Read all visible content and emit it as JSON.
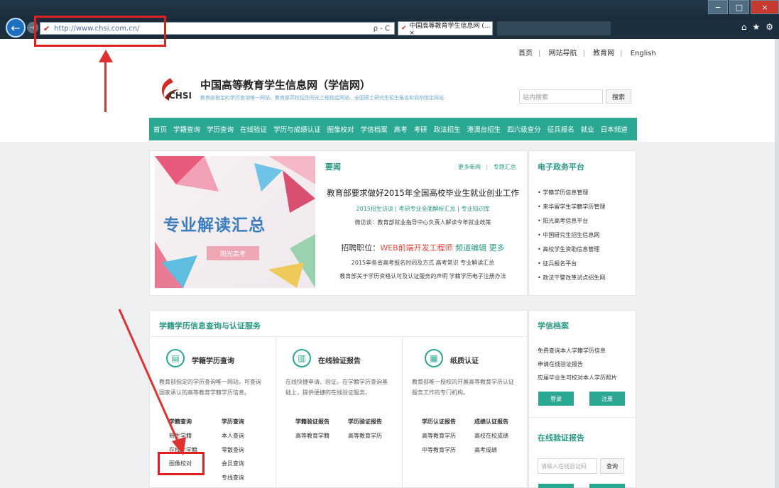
{
  "browser": {
    "url": "http://www.chsi.com.cn/",
    "tab_title": "中国高等教育学生信息网 (... ×",
    "addr_tools": "ρ - C"
  },
  "topnav": [
    "首页",
    "网站导航",
    "教育网",
    "English"
  ],
  "header": {
    "logo_text": "CHSI",
    "title": "中国高等教育学生信息网（学信网）",
    "subtitle": "教育部指定的学历查询唯一网站、教育部高校招生阳光工程指定网站、全国硕士研究生招生报名和调剂指定网站",
    "search_placeholder": "站内搜索",
    "search_button": "搜索"
  },
  "mainnav": [
    "首页",
    "学籍查询",
    "学历查询",
    "在线验证",
    "学历与成绩认证",
    "图像校对",
    "学信档案",
    "高考",
    "考研",
    "政法招生",
    "港澳台招生",
    "四六级查分",
    "征兵报名",
    "就业",
    "日本频道"
  ],
  "banner": {
    "title": "专业解读汇总",
    "button": "阳光高考"
  },
  "news": {
    "section_title": "要闻",
    "more_news": "更多新闻",
    "sep": "|",
    "topics": "专题汇总",
    "headline": "教育部要求做好2015年全国高校毕业生就业创业工作",
    "line1": "2015招生访谈 | 考研专业全面解析汇总 | 专业知识库",
    "line2": "微访谈：教育部就业指导中心负责人解读今年就业政策",
    "recruit_prefix": "招聘职位：",
    "recruit_job": "WEB前端开发工程师",
    "recruit_suffix": " 频道编辑 更多",
    "line3": "2015年各省高考报名时间及方式 高考常识 专业解读汇总",
    "line4": "教育部关于学历资格认可及认证服务的声明 学籍学历电子注册办法"
  },
  "egov": {
    "title": "电子政务平台",
    "items": [
      "• 学籍学历信息管理",
      "• 来华留学生学籍学历管理",
      "• 阳光高考信息平台",
      "• 中国研究生招生信息网",
      "• 高校学生资助信息管理",
      "• 征兵报名平台",
      "• 政法干警改革试点招生网"
    ]
  },
  "services": {
    "title": "学籍学历信息查询与认证服务",
    "cards": [
      {
        "title": "学籍学历查询",
        "desc1": "教育部指定的学历查询唯一网站，可查询",
        "desc2": "国家承认的高等教育学籍学历信息。"
      },
      {
        "title": "在线验证报告",
        "desc1": "在线快捷申请、验证。在学籍学历查询基",
        "desc2": "础上，提供便捷的在线验证服务。"
      },
      {
        "title": "纸质认证",
        "desc1": "教育部唯一授权的开展高等教育学历认证",
        "desc2": "服务工作的专门机构。"
      }
    ],
    "col1a": [
      "学籍查询",
      "新生学籍",
      "在校生学籍",
      "图像校对"
    ],
    "col1b": [
      "学历查询",
      "本人查询",
      "零散查询",
      "会员查询",
      "专线查询"
    ],
    "col2a": [
      "学籍验证报告",
      "高等教育学籍"
    ],
    "col2b": [
      "学历验证报告",
      "高等教育学历"
    ],
    "col3a": [
      "学历认证报告",
      "高等教育学历",
      "中等教育学历"
    ],
    "col3b": [
      "成绩认证报告",
      "高校在校成绩",
      "高考成绩"
    ]
  },
  "archive": {
    "title": "学信档案",
    "lines": [
      "免费查询本人学籍学历信息",
      "申请在线验证报告",
      "应届毕业生可校对本人学历照片"
    ],
    "login": "登录",
    "register": "注册"
  },
  "verify": {
    "title": "在线验证报告",
    "placeholder": "请输入在线验证码",
    "button": "查询"
  },
  "colors": {
    "accent": "#2aa891",
    "highlight": "#e02020"
  }
}
